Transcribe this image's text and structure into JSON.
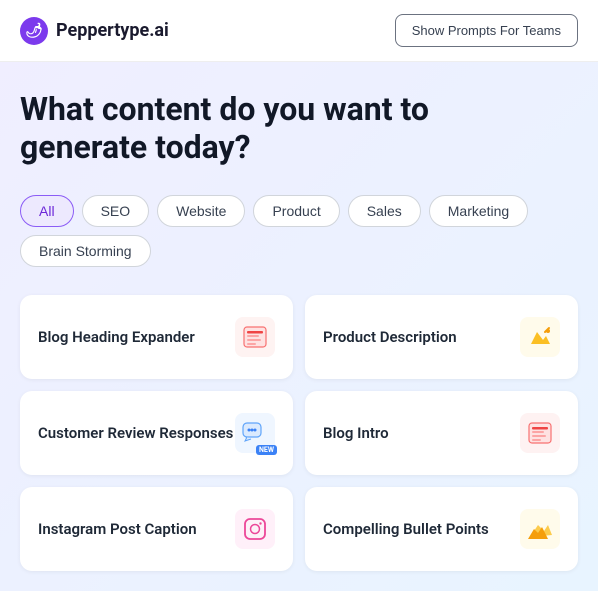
{
  "header": {
    "logo_text": "Peppertype.ai",
    "logo_icon": "🌶",
    "teams_button_label": "Show Prompts For Teams"
  },
  "page": {
    "title_line1": "What content do you want to",
    "title_line2": "generate today?"
  },
  "filters": {
    "tabs": [
      {
        "id": "all",
        "label": "All",
        "active": true
      },
      {
        "id": "seo",
        "label": "SEO",
        "active": false
      },
      {
        "id": "website",
        "label": "Website",
        "active": false
      },
      {
        "id": "product",
        "label": "Product",
        "active": false
      },
      {
        "id": "sales",
        "label": "Sales",
        "active": false
      },
      {
        "id": "marketing",
        "label": "Marketing",
        "active": false
      },
      {
        "id": "brainstorming",
        "label": "Brain Storming",
        "active": false
      }
    ]
  },
  "cards": [
    {
      "id": "blog-heading",
      "label": "Blog Heading Expander",
      "icon": "📰",
      "icon_type": "blog-heading",
      "badge": false
    },
    {
      "id": "product-desc",
      "label": "Product Description",
      "icon": "✏️",
      "icon_type": "product-desc",
      "badge": false
    },
    {
      "id": "customer-review",
      "label": "Customer Review Responses",
      "icon": "💬",
      "icon_type": "review",
      "badge": true
    },
    {
      "id": "blog-intro",
      "label": "Blog Intro",
      "icon": "📰",
      "icon_type": "blog-intro",
      "badge": false
    },
    {
      "id": "instagram",
      "label": "Instagram Post Caption",
      "icon": "📷",
      "icon_type": "instagram",
      "badge": false
    },
    {
      "id": "bullet-points",
      "label": "Compelling Bullet Points",
      "icon": "📋",
      "icon_type": "bullet",
      "badge": false
    }
  ],
  "icons": {
    "blog_heading": "📰",
    "product_desc": "✏",
    "review": "💬",
    "blog_intro": "📰",
    "instagram": "📷",
    "bullet": "📋"
  }
}
